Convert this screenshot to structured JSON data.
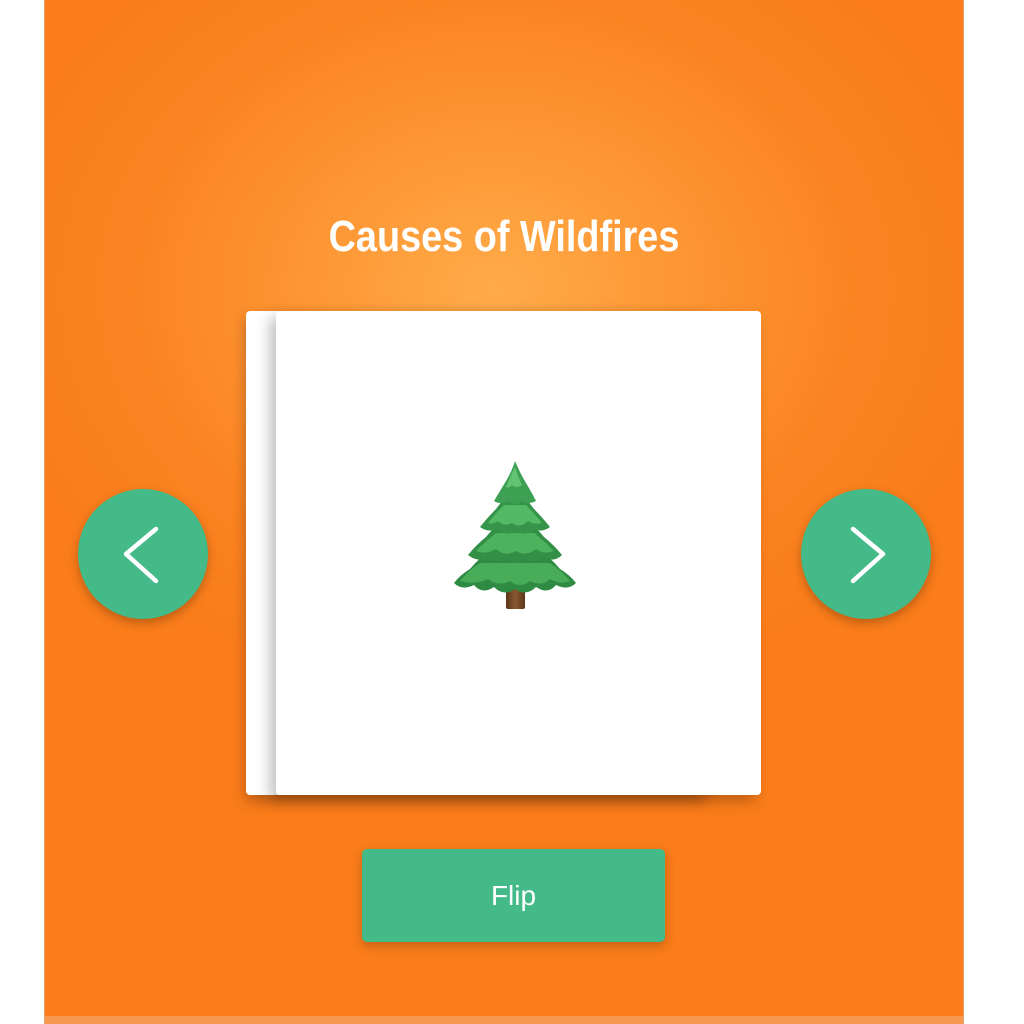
{
  "deck": {
    "title": "Causes of Wildfires"
  },
  "card": {
    "image": "evergreen-tree-emoji"
  },
  "navigation": {
    "previous_icon": "chevron-left-icon",
    "next_icon": "chevron-right-icon"
  },
  "controls": {
    "flip_label": "Flip"
  },
  "colors": {
    "background": "#fb8321",
    "background_highlight": "#ffab4a",
    "accent": "#43ba88",
    "card": "#ffffff",
    "title_text": "#ffffff"
  }
}
